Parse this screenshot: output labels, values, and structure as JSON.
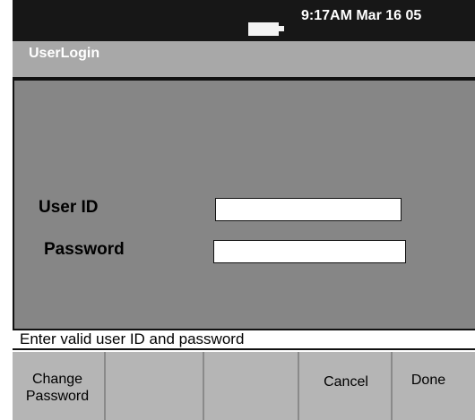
{
  "status": {
    "time": "9:17AM Mar 16 05"
  },
  "window": {
    "title": "UserLogin"
  },
  "form": {
    "user_id_label": "User ID",
    "user_id_value": "",
    "password_label": "Password",
    "password_value": ""
  },
  "message": "Enter valid user ID and password",
  "softkeys": {
    "change_password_line1": "Change",
    "change_password_line2": "Password",
    "key2": "",
    "key3": "",
    "cancel": "Cancel",
    "done": "Done"
  },
  "icons": {
    "battery": "battery-icon"
  },
  "colors": {
    "status_bar": "#171717",
    "title_bar": "#a8a8a8",
    "panel": "#868686",
    "softkey_bg": "#b5b5b5"
  }
}
